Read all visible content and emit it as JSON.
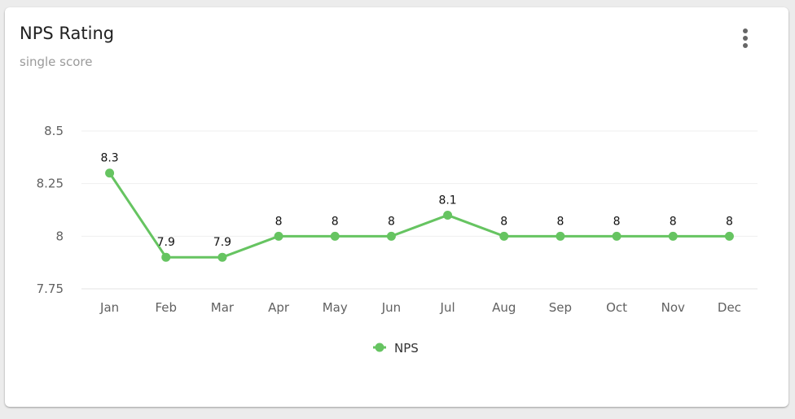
{
  "card": {
    "title": "NPS Rating",
    "subtitle": "single score",
    "menu_icon": "more-vertical-icon"
  },
  "colors": {
    "series": "#66c461",
    "grid": "#efefef"
  },
  "chart_data": {
    "type": "line",
    "title": "NPS Rating",
    "subtitle": "single score",
    "xlabel": "",
    "ylabel": "",
    "categories": [
      "Jan",
      "Feb",
      "Mar",
      "Apr",
      "May",
      "Jun",
      "Jul",
      "Aug",
      "Sep",
      "Oct",
      "Nov",
      "Dec"
    ],
    "series": [
      {
        "name": "NPS",
        "values": [
          8.3,
          7.9,
          7.9,
          8,
          8,
          8,
          8.1,
          8,
          8,
          8,
          8,
          8
        ]
      }
    ],
    "data_labels": [
      "8.3",
      "7.9",
      "7.9",
      "8",
      "8",
      "8",
      "8.1",
      "8",
      "8",
      "8",
      "8",
      "8"
    ],
    "yticks": [
      7.75,
      8,
      8.25,
      8.5
    ],
    "ytick_labels": [
      "7.75",
      "8",
      "8.25",
      "8.5"
    ],
    "ylim": [
      7.75,
      8.5
    ],
    "grid": true,
    "legend": {
      "position": "bottom-center",
      "entries": [
        "NPS"
      ]
    }
  }
}
